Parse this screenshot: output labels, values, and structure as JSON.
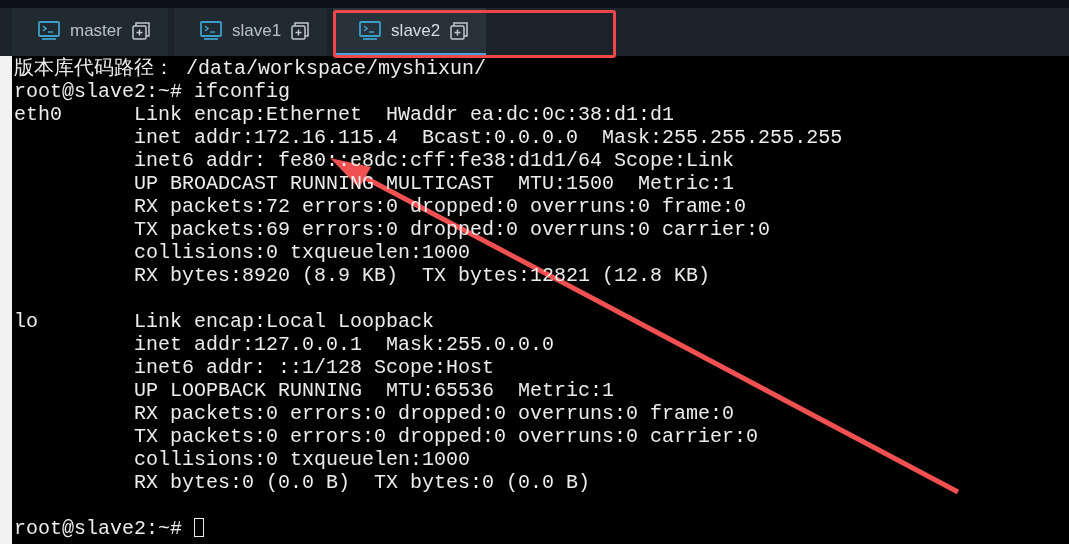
{
  "tabs": [
    {
      "label": "master",
      "selected": false
    },
    {
      "label": "slave1",
      "selected": false
    },
    {
      "label": "slave2",
      "selected": true
    }
  ],
  "terminal": {
    "cursor": true,
    "lines": [
      {
        "kind": "text",
        "text": "版本库代码路径： /data/workspace/myshixun/"
      },
      {
        "kind": "text",
        "text": "root@slave2:~# ifconfig"
      },
      {
        "kind": "text",
        "text": "eth0      Link encap:Ethernet  HWaddr ea:dc:0c:38:d1:d1"
      },
      {
        "kind": "text",
        "text": "          inet addr:172.16.115.4  Bcast:0.0.0.0  Mask:255.255.255.255"
      },
      {
        "kind": "text",
        "text": "          inet6 addr: fe80::e8dc:cff:fe38:d1d1/64 Scope:Link"
      },
      {
        "kind": "text",
        "text": "          UP BROADCAST RUNNING MULTICAST  MTU:1500  Metric:1"
      },
      {
        "kind": "text",
        "text": "          RX packets:72 errors:0 dropped:0 overruns:0 frame:0"
      },
      {
        "kind": "text",
        "text": "          TX packets:69 errors:0 dropped:0 overruns:0 carrier:0"
      },
      {
        "kind": "text",
        "text": "          collisions:0 txqueuelen:1000"
      },
      {
        "kind": "text",
        "text": "          RX bytes:8920 (8.9 KB)  TX bytes:12821 (12.8 KB)"
      },
      {
        "kind": "blank"
      },
      {
        "kind": "text",
        "text": "lo        Link encap:Local Loopback"
      },
      {
        "kind": "text",
        "text": "          inet addr:127.0.0.1  Mask:255.0.0.0"
      },
      {
        "kind": "text",
        "text": "          inet6 addr: ::1/128 Scope:Host"
      },
      {
        "kind": "text",
        "text": "          UP LOOPBACK RUNNING  MTU:65536  Metric:1"
      },
      {
        "kind": "text",
        "text": "          RX packets:0 errors:0 dropped:0 overruns:0 frame:0"
      },
      {
        "kind": "text",
        "text": "          TX packets:0 errors:0 dropped:0 overruns:0 carrier:0"
      },
      {
        "kind": "text",
        "text": "          collisions:0 txqueuelen:1000"
      },
      {
        "kind": "text",
        "text": "          RX bytes:0 (0.0 B)  TX bytes:0 (0.0 B)"
      },
      {
        "kind": "blank"
      },
      {
        "kind": "text",
        "text": "root@slave2:~# "
      }
    ]
  }
}
